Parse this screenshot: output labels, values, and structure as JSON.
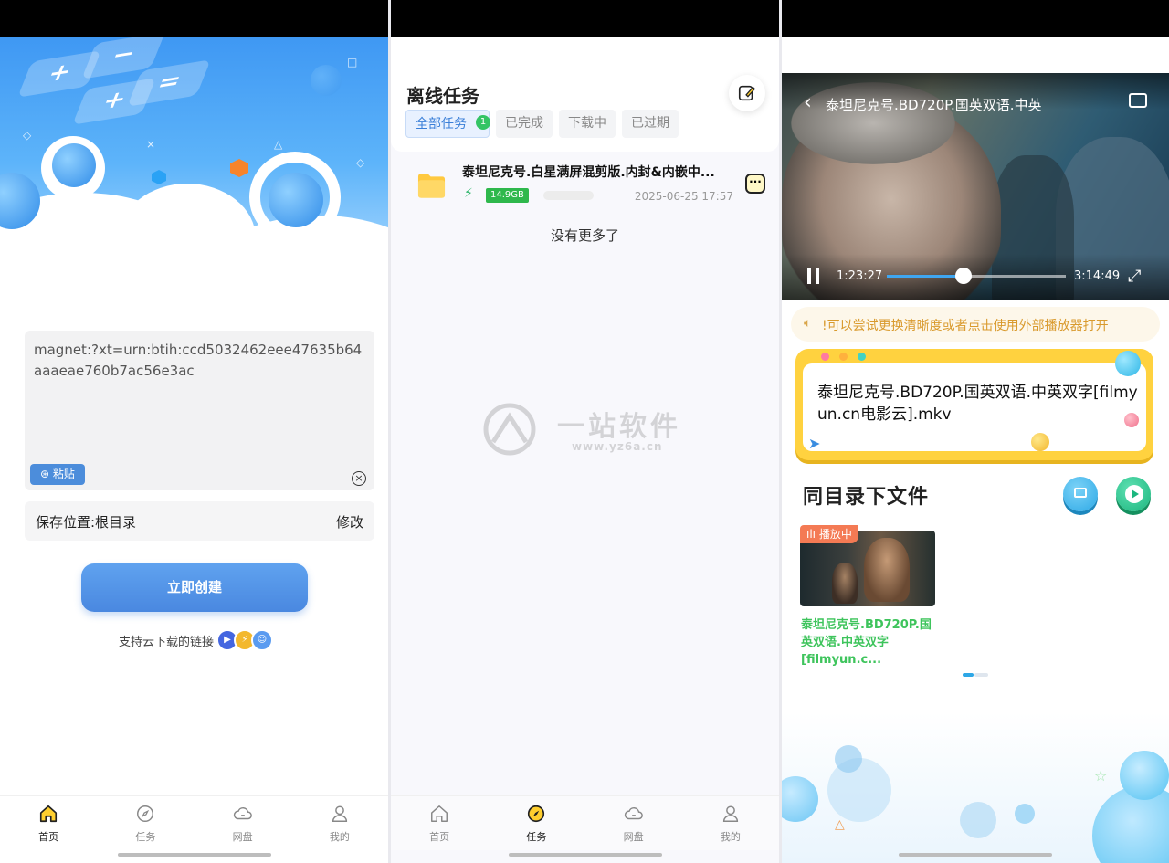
{
  "panel1": {
    "magnet_text": "magnet:?xt=urn:btih:ccd5032462eee47635b64aaaeae760b7ac56e3ac",
    "paste_label": "粘贴",
    "save_location": "保存位置:根目录",
    "modify_label": "修改",
    "create_button": "立即创建",
    "support_text": "支持云下载的链接"
  },
  "tabs": [
    {
      "label": "首页",
      "icon": "home-icon"
    },
    {
      "label": "任务",
      "icon": "compass-icon"
    },
    {
      "label": "网盘",
      "icon": "cloud-icon"
    },
    {
      "label": "我的",
      "icon": "user-icon"
    }
  ],
  "panel2": {
    "title": "离线任务",
    "filters": [
      {
        "label": "全部任务",
        "badge": "1"
      },
      {
        "label": "已完成"
      },
      {
        "label": "下载中"
      },
      {
        "label": "已过期"
      }
    ],
    "task": {
      "title": "泰坦尼克号.白星满屏混剪版.内封&内嵌中...",
      "size": "14.9GB",
      "time": "2025-06-25 17:57"
    },
    "no_more": "没有更多了",
    "watermark": {
      "main": "一站软件",
      "sub": "www.yz6a.cn"
    }
  },
  "panel3": {
    "player_title": "泰坦尼克号.BD720P.国英双语.中英",
    "current_time": "1:23:27",
    "total_time": "3:14:49",
    "progress": 0.43,
    "tip": "!可以尝试更换清晰度或者点击使用外部播放器打开",
    "file_name": "泰坦尼克号.BD720P.国英双语.中英双字[filmyun.cn电影云].mkv",
    "same_dir_title": "同目录下文件",
    "playing_badge": "播放中",
    "thumb_name": "泰坦尼克号.BD720P.国英双语.中英双字[filmyun.c..."
  },
  "colors": {
    "accent_blue": "#4a88e0",
    "green": "#2fb84c",
    "tip_orange": "#d99a2d",
    "card_yellow": "#ffd23f"
  }
}
